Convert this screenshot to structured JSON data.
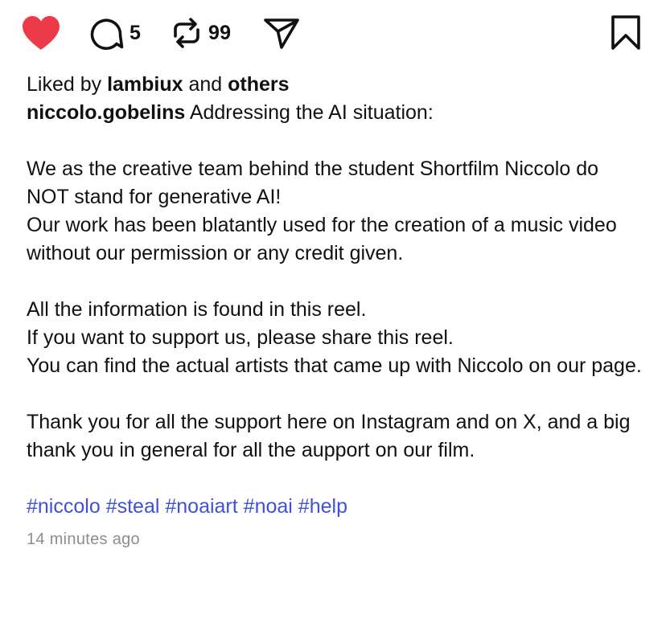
{
  "colors": {
    "like": "#ed3a49",
    "text": "#111111",
    "hashtag": "#3f51d6",
    "muted": "#8e8e8e"
  },
  "actions": {
    "like_icon": "heart-filled-icon",
    "comment_icon": "comment-bubble-icon",
    "comment_count": "5",
    "repost_icon": "repost-arrows-icon",
    "repost_count": "99",
    "share_icon": "paper-plane-icon",
    "save_icon": "bookmark-icon"
  },
  "liked_by": {
    "prefix": "Liked by ",
    "user": "lambiux",
    "middle": " and ",
    "others": "others"
  },
  "post": {
    "username": "niccolo.gobelins",
    "first_line": " Addressing the AI situation:",
    "paragraphs": [
      [
        "We as the creative team behind the student Shortfilm Niccolo do NOT stand for generative AI!",
        "Our work has been blatantly used for the creation of a music video without our permission or any credit given."
      ],
      [
        "All the information is found in this reel.",
        "If you want to support us, please share this reel.",
        "You can find the actual artists that came up with Niccolo on our page."
      ],
      [
        "Thank you for all the support here on Instagram and on X, and a big thank you in general for all the aupport on our film."
      ]
    ],
    "hashtags": [
      "#niccolo",
      "#steal",
      "#noaiart",
      "#noai",
      "#help"
    ],
    "timestamp": "14 minutes ago"
  }
}
